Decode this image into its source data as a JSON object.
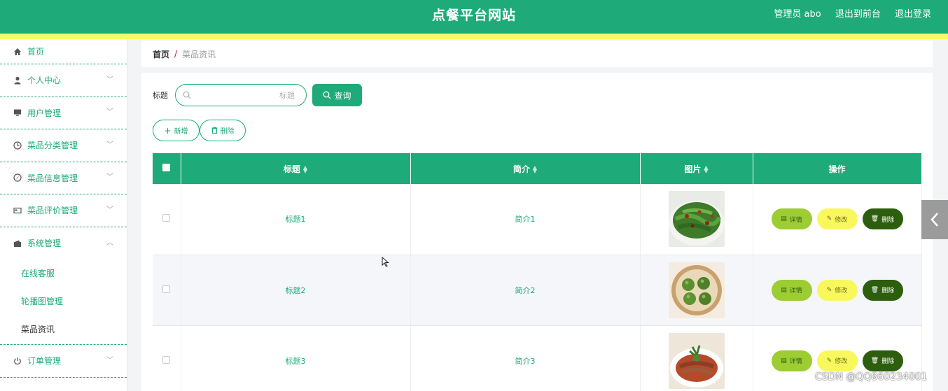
{
  "header": {
    "site_title": "点餐平台网站",
    "user_label": "管理员 abo",
    "to_front_label": "退出到前台",
    "logout_label": "退出登录"
  },
  "sidebar": {
    "items": [
      {
        "label": "首页",
        "icon": "home-icon"
      },
      {
        "label": "个人中心",
        "icon": "user-icon"
      },
      {
        "label": "用户管理",
        "icon": "monitor-icon"
      },
      {
        "label": "菜品分类管理",
        "icon": "clock-icon"
      },
      {
        "label": "菜品信息管理",
        "icon": "compass-icon"
      },
      {
        "label": "菜品评价管理",
        "icon": "id-card-icon"
      },
      {
        "label": "系统管理",
        "icon": "wallet-icon"
      },
      {
        "label": "订单管理",
        "icon": "power-icon"
      }
    ],
    "system_sub": [
      {
        "label": "在线客服"
      },
      {
        "label": "轮播图管理"
      },
      {
        "label": "菜品资讯"
      }
    ]
  },
  "breadcrumb": {
    "home": "首页",
    "separator": "/",
    "current": "菜品资讯"
  },
  "search": {
    "label": "标题",
    "placeholder": "标题",
    "query_label": "查询"
  },
  "actions": {
    "add_label": "新增",
    "delete_label": "删除"
  },
  "table": {
    "columns": [
      "标题",
      "简介",
      "图片",
      "操作"
    ],
    "rows": [
      {
        "title": "标题1",
        "intro": "简介1",
        "image": "stir-fried-green-peppers"
      },
      {
        "title": "标题2",
        "intro": "简介2",
        "image": "green-dumplings-in-steamer"
      },
      {
        "title": "标题3",
        "intro": "简介3",
        "image": "sliced-beef-with-herbs"
      }
    ],
    "op_detail": "详情",
    "op_edit": "修改",
    "op_delete": "删除"
  },
  "watermark": "CSDN @QQ860234001",
  "colors": {
    "primary": "#1eaa79",
    "accent_yellow": "#f3fb6a",
    "detail_btn": "#9dcc33",
    "edit_btn": "#f8f85c",
    "delete_btn": "#2c5e0e"
  }
}
